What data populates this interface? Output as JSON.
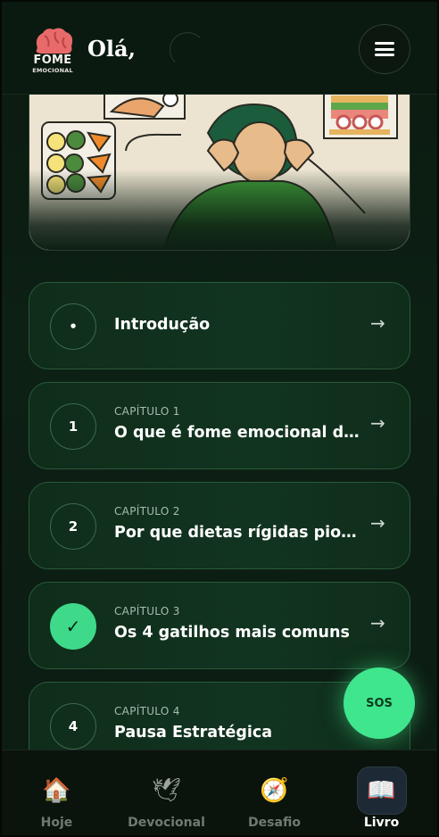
{
  "header": {
    "logo_line1": "FOME",
    "logo_line2": "EMOCIONAL",
    "greeting": "Olá,",
    "menu_icon": "hamburger-menu-icon"
  },
  "chapters": [
    {
      "kicker": "",
      "title": "Introdução",
      "marker": "•",
      "done": false
    },
    {
      "kicker": "CAPÍTULO 1",
      "title": "O que é fome emocional d...",
      "marker": "1",
      "done": false
    },
    {
      "kicker": "CAPÍTULO 2",
      "title": "Por que dietas rígidas pior...",
      "marker": "2",
      "done": false
    },
    {
      "kicker": "CAPÍTULO 3",
      "title": "Os 4 gatilhos mais comuns",
      "marker": "✓",
      "done": true
    },
    {
      "kicker": "CAPÍTULO 4",
      "title": "Pausa Estratégica",
      "marker": "4",
      "done": false
    }
  ],
  "arrow": "→",
  "sos": {
    "label": "SOS",
    "color": "#3fe68d"
  },
  "nav": [
    {
      "label": "Hoje",
      "icon": "house-icon",
      "glyph": "🏠",
      "active": false
    },
    {
      "label": "Devocional",
      "icon": "dove-icon",
      "glyph": "🕊",
      "active": false
    },
    {
      "label": "Desafio",
      "icon": "compass-icon",
      "glyph": "🧭",
      "active": false
    },
    {
      "label": "Livro",
      "icon": "book-icon",
      "glyph": "📖",
      "active": true
    }
  ],
  "colors": {
    "accent": "#3fd98a",
    "card_border": "#2a5a3a",
    "background": "#0b1a10"
  }
}
